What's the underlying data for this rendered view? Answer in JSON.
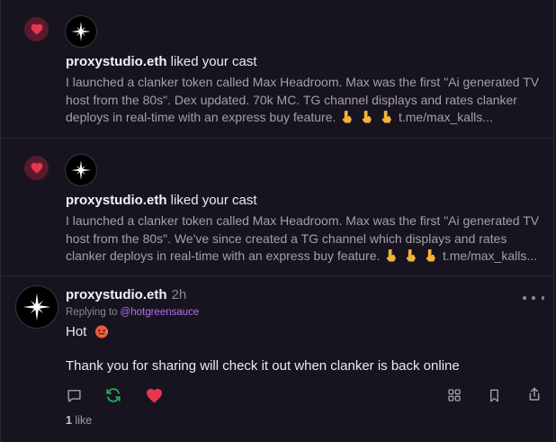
{
  "notifications": [
    {
      "icon": "heart-icon",
      "username": "proxystudio.eth",
      "action": " liked your cast",
      "body": "I launched a clanker token called Max Headroom. Max was the first \"Ai generated TV host from the 80s\". Dex updated. 70k MC. TG channel displays and rates clanker deploys in real-time with an express buy feature.",
      "link": "t.me/max_kalls..."
    },
    {
      "icon": "heart-icon",
      "username": "proxystudio.eth",
      "action": " liked your cast",
      "body": "I launched a clanker token called Max Headroom. Max was the first \"Ai generated TV host from the 80s\". We've since created a TG channel which displays and rates clanker deploys in real-time with an express buy feature.",
      "link": "t.me/max_kalls..."
    }
  ],
  "cast": {
    "username": "proxystudio.eth",
    "time": "2h",
    "replying_label": "Replying to",
    "replying_to": "@hotgreensauce",
    "text_line1": "Hot",
    "text_line2": "Thank you for sharing will check it out when clanker is back online",
    "likes_count": "1",
    "likes_label": "like"
  },
  "colors": {
    "background": "#18141f",
    "like_red": "#e5374f",
    "recast_green": "#1fae5b",
    "mention_purple": "#b16ff2",
    "muted_text": "#a39fab"
  }
}
